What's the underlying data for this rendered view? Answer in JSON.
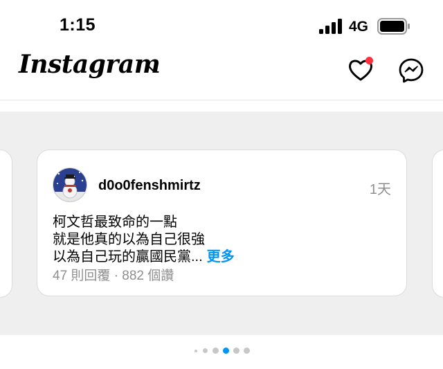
{
  "status_bar": {
    "time": "1:15",
    "network": "4G",
    "signal_icon": "cellular-signal-icon",
    "battery_icon": "battery-icon"
  },
  "header": {
    "logo": "Instagram",
    "logo_menu_icon": "chevron-down-icon",
    "activity_icon": "heart-icon",
    "messages_icon": "messenger-icon",
    "notification_color": "#ff3040"
  },
  "carousel": {
    "active_index": 3,
    "dot_count": 6,
    "card": {
      "username": "d0o0fenshmirtz",
      "time": "1天",
      "text_lines": [
        "柯文哲最致命的一點",
        "就是他真的以為自己很強",
        "以為自己玩的贏國民黨..."
      ],
      "more": "更多",
      "stats": "47 則回覆 · 882 個讚",
      "link_color": "#0095f6"
    }
  }
}
